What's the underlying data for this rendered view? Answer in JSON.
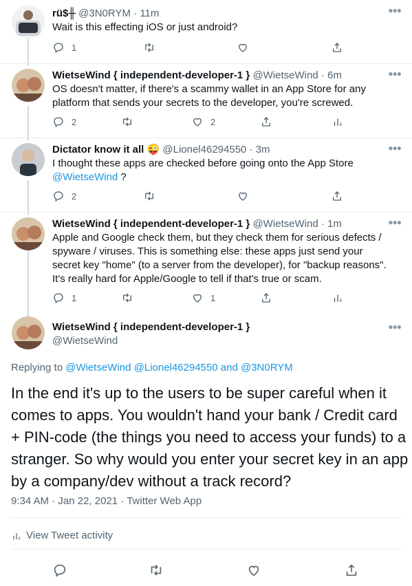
{
  "tweets": [
    {
      "name": "rü$╫",
      "handle": "@3N0RYM",
      "time": "11m",
      "text": "Wait is this effecting iOS or just android?",
      "reply_count": "1",
      "retweet_count": "",
      "like_count": ""
    },
    {
      "name": "WietseWind { independent-developer-1 }",
      "handle": "@WietseWind",
      "time": "6m",
      "text": "OS doesn't matter, if there's a scammy wallet in an App Store for any platform that sends your secrets to the developer, you're screwed.",
      "reply_count": "2",
      "retweet_count": "",
      "like_count": "2"
    },
    {
      "name": "Dictator know it all 😜",
      "handle": "@Lionel46294550",
      "time": "3m",
      "text": "I thought these apps are checked before going onto the App Store",
      "mention": "@WietseWind",
      "after_mention": " ?",
      "reply_count": "2",
      "retweet_count": "",
      "like_count": ""
    },
    {
      "name": "WietseWind { independent-developer-1 }",
      "handle": "@WietseWind",
      "time": "1m",
      "text": "Apple and Google check them, but they check them for serious defects / spyware / viruses. This is something else: these apps just send your secret key \"home\" (to a server from the developer), for \"backup reasons\". It's really hard for Apple/Google to tell if that's true or scam.",
      "reply_count": "1",
      "retweet_count": "",
      "like_count": "1"
    }
  ],
  "main_tweet": {
    "name": "WietseWind { independent-developer-1 }",
    "handle": "@WietseWind",
    "replying_prefix": "Replying to ",
    "replying_to": "@WietseWind @Lionel46294550 and @3N0RYM",
    "text": "In the end it's up to the users to be super careful when it comes to apps. You wouldn't hand your bank / Credit card + PIN-code (the things you need to access your funds) to a stranger. So why would you enter your secret key in an app by a company/dev without a track record?",
    "time": "9:34 AM",
    "date": "Jan 22, 2021",
    "source": "Twitter Web App",
    "activity_label": "View Tweet activity"
  },
  "colors": {
    "link": "#1b95e0",
    "secondary": "#536471",
    "divider": "#e6ecf0"
  },
  "icons": [
    "reply-icon",
    "retweet-icon",
    "like-icon",
    "share-icon",
    "analytics-icon",
    "more-icon"
  ]
}
